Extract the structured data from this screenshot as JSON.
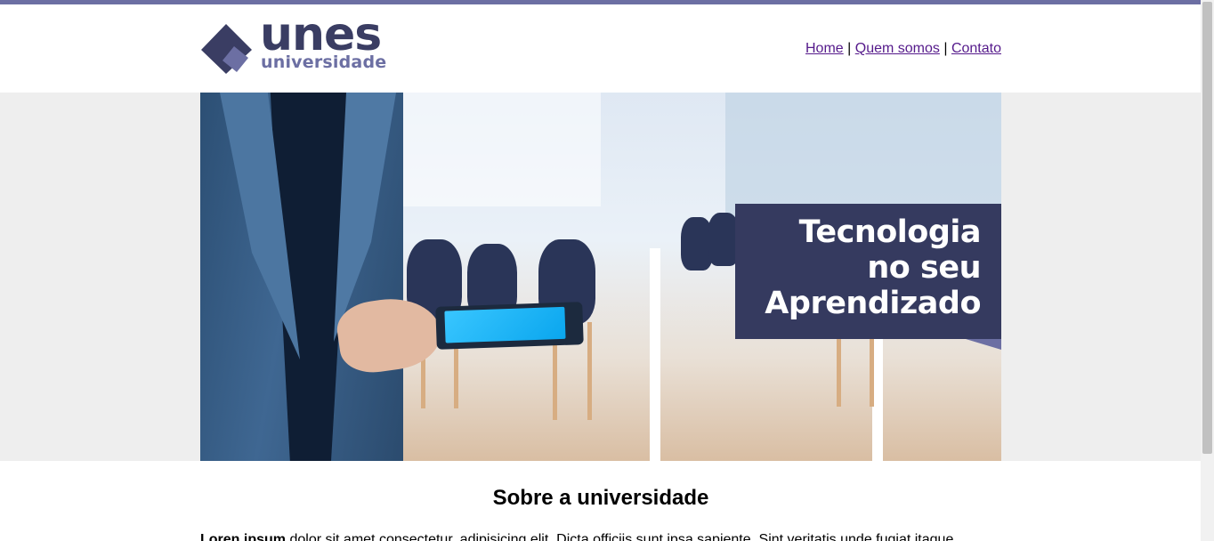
{
  "brand": {
    "name": "unes",
    "subtitle": "universidade",
    "primary_color": "#3a3d63",
    "accent_color": "#6c6fa3"
  },
  "nav": {
    "items": [
      {
        "label": "Home"
      },
      {
        "label": "Quem somos"
      },
      {
        "label": "Contato"
      }
    ],
    "separator": "|"
  },
  "hero": {
    "tagline_lines": [
      "Tecnologia",
      "no seu",
      "Aprendizado"
    ]
  },
  "main": {
    "section_title": "Sobre a universidade",
    "intro_bold": "Loren ipsum",
    "intro_text": " dolor sit amet consectetur, adipisicing elit. Dicta officiis sunt ipsa sapiente. Sint veritatis unde fugiat itaque."
  }
}
